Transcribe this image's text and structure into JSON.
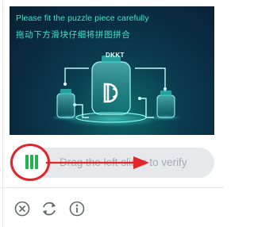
{
  "puzzle": {
    "instruction_en": "Please fit the puzzle piece carefully",
    "instruction_zh": "拖动下方滑块仔细将拼图拼合",
    "brand": "DKKT"
  },
  "slider": {
    "hint": "Drag the left slider to verify",
    "progress": 0
  },
  "footer": {
    "icons": [
      "close-icon",
      "refresh-icon",
      "info-icon"
    ]
  },
  "colors": {
    "accent_text": "#3ce6c6",
    "knob_bars": "#22b14c",
    "annotation": "#e0262b",
    "track": "#e6e8eb"
  }
}
